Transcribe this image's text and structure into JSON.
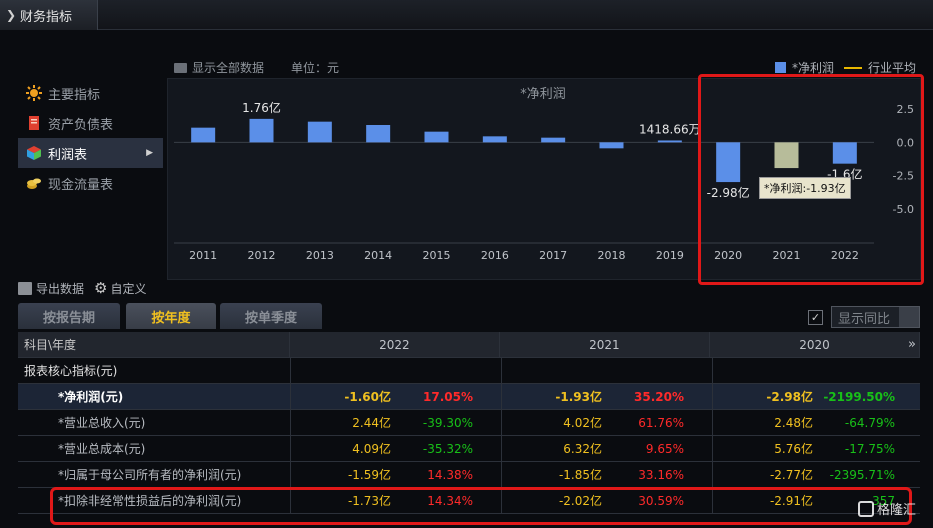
{
  "window": {
    "title": "财务指标"
  },
  "sidebar": {
    "items": [
      {
        "label": "主要指标",
        "icon": "sun-icon",
        "active": false
      },
      {
        "label": "资产负债表",
        "icon": "document-icon",
        "active": false
      },
      {
        "label": "利润表",
        "icon": "cube-icon",
        "active": true
      },
      {
        "label": "现金流量表",
        "icon": "coins-icon",
        "active": false
      }
    ]
  },
  "chart_toolbar": {
    "show_all": "显示全部数据",
    "unit": "单位：元"
  },
  "legend": {
    "series": "*净利润",
    "avg": "行业平均"
  },
  "tooltip": "*净利润:-1.93亿",
  "chart_data": {
    "type": "bar",
    "title": "*净利润",
    "categories": [
      "2011",
      "2012",
      "2013",
      "2014",
      "2015",
      "2016",
      "2017",
      "2018",
      "2019",
      "2020",
      "2021",
      "2022"
    ],
    "series": [
      {
        "name": "*净利润",
        "values": [
          1.1,
          1.76,
          1.55,
          1.3,
          0.8,
          0.45,
          0.35,
          -0.45,
          0.14,
          -2.98,
          -1.93,
          -1.6
        ],
        "colors": [
          "#5b8fe8",
          "#5b8fe8",
          "#5b8fe8",
          "#5b8fe8",
          "#5b8fe8",
          "#5b8fe8",
          "#5b8fe8",
          "#5b8fe8",
          "#5b8fe8",
          "#5b8fe8",
          "#b7bc9a",
          "#5b8fe8"
        ]
      }
    ],
    "data_labels": [
      {
        "index": 1,
        "text": "1.76亿"
      },
      {
        "index": 8,
        "text": "1418.66万"
      },
      {
        "index": 9,
        "text": "-2.98亿"
      },
      {
        "index": 11,
        "text": "-1.6亿"
      }
    ],
    "yticks": [
      "2.5",
      "0.0",
      "-2.5",
      "-5.0"
    ],
    "ytick_values": [
      2.5,
      0,
      -2.5,
      -5
    ],
    "ylim": [
      -5.0,
      2.5
    ]
  },
  "tools": {
    "export": "导出数据",
    "customize": "自定义"
  },
  "tabs": [
    "按报告期",
    "按年度",
    "按单季度"
  ],
  "active_tab": 1,
  "show_yoy": {
    "label": "显示同比",
    "checked": "✓"
  },
  "table": {
    "header": {
      "col0": "科目\\年度",
      "years": [
        "2022",
        "2021",
        "2020"
      ]
    },
    "section": "报表核心指标(元)",
    "rows": [
      {
        "label": "*净利润(元)",
        "cells": [
          [
            "-1.60亿",
            "17.05%",
            "red"
          ],
          [
            "-1.93亿",
            "35.20%",
            "red"
          ],
          [
            "-2.98亿",
            "-2199.50%",
            "green"
          ]
        ]
      },
      {
        "label": "*营业总收入(元)",
        "cells": [
          [
            "2.44亿",
            "-39.30%",
            "green"
          ],
          [
            "4.02亿",
            "61.76%",
            "red"
          ],
          [
            "2.48亿",
            "-64.79%",
            "green"
          ]
        ]
      },
      {
        "label": "*营业总成本(元)",
        "cells": [
          [
            "4.09亿",
            "-35.32%",
            "green"
          ],
          [
            "6.32亿",
            "9.65%",
            "red"
          ],
          [
            "5.76亿",
            "-17.75%",
            "green"
          ]
        ]
      },
      {
        "label": "*归属于母公司所有者的净利润(元)",
        "cells": [
          [
            "-1.59亿",
            "14.38%",
            "red"
          ],
          [
            "-1.85亿",
            "33.16%",
            "red"
          ],
          [
            "-2.77亿",
            "-2395.71%",
            "green"
          ]
        ]
      },
      {
        "label": "*扣除非经常性损益后的净利润(元)",
        "cells": [
          [
            "-1.73亿",
            "14.34%",
            "red"
          ],
          [
            "-2.02亿",
            "30.59%",
            "red"
          ],
          [
            "-2.91亿",
            "-357",
            "green"
          ]
        ]
      }
    ]
  },
  "watermark": "格隆汇"
}
